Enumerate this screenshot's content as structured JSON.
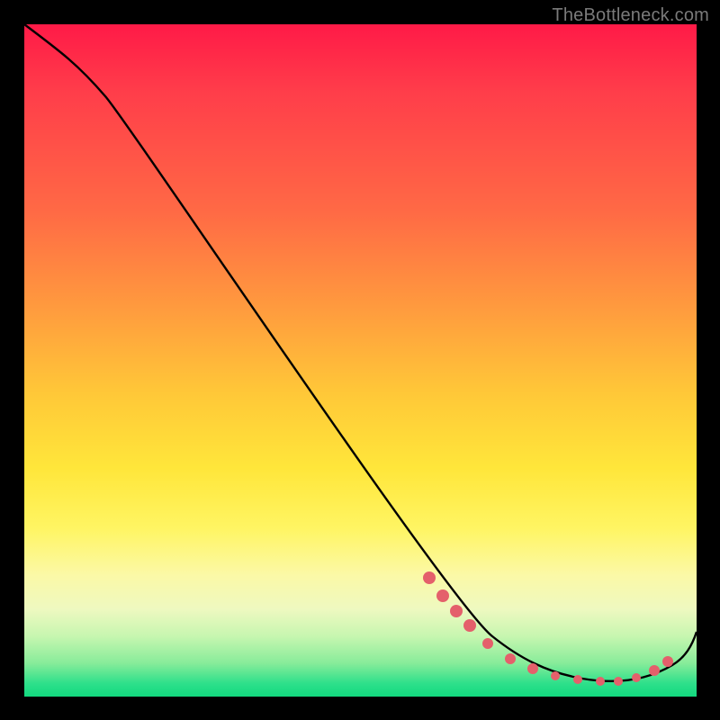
{
  "watermark": {
    "text": "TheBottleneck.com"
  },
  "chart_data": {
    "type": "line",
    "title": "",
    "xlabel": "",
    "ylabel": "",
    "xlim": [
      0,
      100
    ],
    "ylim": [
      0,
      100
    ],
    "grid": false,
    "series": [
      {
        "name": "bottleneck-curve",
        "x": [
          0,
          6,
          12,
          18,
          24,
          30,
          36,
          42,
          48,
          54,
          60,
          66,
          70,
          74,
          78,
          82,
          86,
          90,
          94,
          98,
          100
        ],
        "y": [
          100,
          97,
          92,
          85,
          77,
          69,
          61,
          53,
          45,
          37,
          29,
          21,
          15,
          10,
          6,
          3.5,
          2.5,
          2.5,
          3.5,
          7,
          10
        ]
      }
    ],
    "markers": {
      "name": "highlight-points",
      "color": "#e4606b",
      "x": [
        60,
        62,
        64,
        66,
        70,
        73,
        76,
        79,
        82,
        85,
        88,
        90,
        93,
        95
      ],
      "y": [
        18,
        16,
        14,
        12,
        8,
        6,
        4.5,
        3.8,
        3.2,
        3.0,
        3.0,
        3.2,
        4.5,
        6.0
      ]
    }
  },
  "colors": {
    "curve_stroke": "#000000",
    "marker_fill": "#e4606b"
  }
}
